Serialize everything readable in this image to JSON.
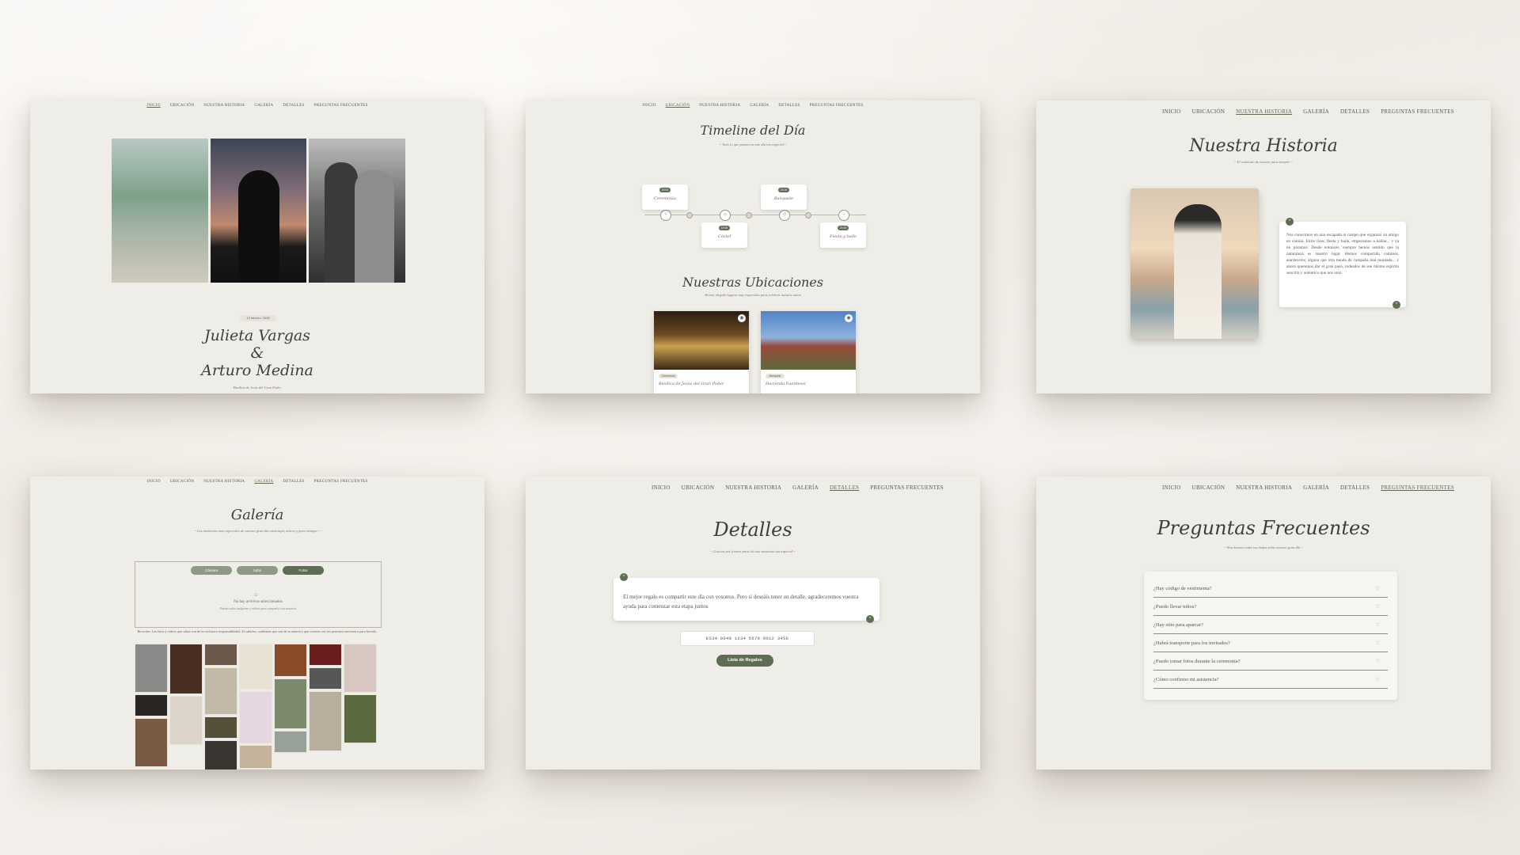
{
  "nav": [
    "Inicio",
    "Ubicación",
    "Nuestra Historia",
    "Galería",
    "Detalles",
    "Preguntas Frecuentes"
  ],
  "inicio": {
    "date": "13 febrero, 2026",
    "name1": "Julieta Vargas",
    "amp": "&",
    "name2": "Arturo Medina",
    "venue": "Basílica de Jesús del Gran Poder"
  },
  "timeline": {
    "title": "Timeline del Día",
    "subtitle": "~ Todo lo que pasará en este día tan especial ~",
    "events": [
      {
        "time": "18:00",
        "label": "Ceremonia"
      },
      {
        "time": "19:00",
        "label": "Cóctel"
      },
      {
        "time": "21:00",
        "label": "Banquete"
      },
      {
        "time": "23:00",
        "label": "Fiesta y baile"
      }
    ]
  },
  "ubicaciones": {
    "title": "Nuestras Ubicaciones",
    "subtitle": "Hemos elegido lugares muy especiales para celebrar nuestra unión",
    "places": [
      {
        "tag": "Ceremonia",
        "name": "Basílica de Jesús del Gran Poder"
      },
      {
        "tag": "Banquete",
        "name": "Hacienda Fuentesol"
      }
    ]
  },
  "historia": {
    "title": "Nuestra Historia",
    "subtitle": "~ El comienzo de nuestro para siempre ~",
    "text": "Nos conocimos en una escapada al campo que organizó un amigo en común. Entre risas, fiesta y baile, empezamos a hablar... y ya no paramos. Desde entonces, siempre hemos sentido que la naturaleza es nuestro lugar. Hemos compartido caminos, atardeceres, alguna que otra tienda de campaña mal montada... y ahora queremos dar el gran paso, rodeados de ese mismo espíritu sencillo y auténtico que nos unió."
  },
  "galeria": {
    "title": "Galería",
    "subtitle": "~ Los momentos más especiales de nuestro gran día están aquí, únicos y para siempre ~",
    "buttons": [
      "Cámara",
      "Subir",
      "Fotos"
    ],
    "empty": "No hay archivos seleccionados",
    "empty_hint": "Puedes subir imágenes y videos para compartir con nosotros",
    "note": "Recordar: Las fotos y videos que subas son de tu exclusiva responsabilidad. Al subirlos, confirmas que son de tu autoría y que cuentas con los permisos necesarios para hacerlo."
  },
  "detalles": {
    "title": "Detalles",
    "subtitle": "~ Gracias por formar parte de este momento tan especial ~",
    "text": "El mejor regalo es compartir este día con vosotros. Pero si deseáis tener un detalle, agradeceremos vuestra ayuda para comenzar esta etapa juntos",
    "iban": "ES34 0049 1234 5678 9012 3456",
    "button": "Lista de Regalos"
  },
  "faq": {
    "title": "Preguntas Frecuentes",
    "subtitle": "~ Resolvemos todas tus dudas sobre nuestro gran día ~",
    "items": [
      "¿Hay código de vestimenta?",
      "¿Puedo llevar niños?",
      "¿Hay sitio para aparcar?",
      "¿Habrá transporte para los invitados?",
      "¿Puedo tomar fotos durante la ceremonia?",
      "¿Cómo confirmo mi asistencia?"
    ]
  }
}
